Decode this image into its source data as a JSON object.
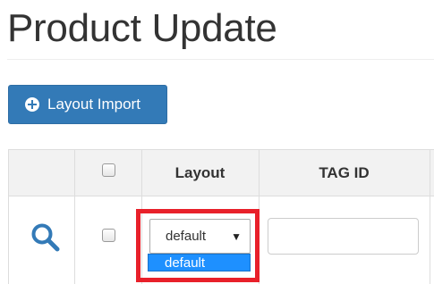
{
  "page": {
    "title": "Product Update"
  },
  "toolbar": {
    "import_label": "Layout Import"
  },
  "table": {
    "headers": [
      "",
      "",
      "Layout",
      "TAG ID",
      ""
    ],
    "rows": [
      {
        "layout_value": "default",
        "tag_id": ""
      }
    ]
  },
  "dropdown": {
    "options": [
      "default"
    ]
  },
  "colors": {
    "primary": "#337ab7",
    "highlight": "#e8202a",
    "selected_option": "#1e90ff"
  }
}
